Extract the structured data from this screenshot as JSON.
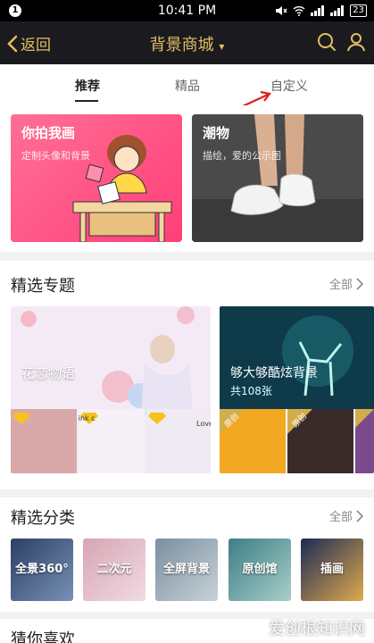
{
  "status_bar": {
    "notification_count": "1",
    "time": "10:41 PM",
    "battery": "23"
  },
  "nav": {
    "back_label": "返回",
    "title": "背景商城",
    "title_caret": "▾"
  },
  "tabs": [
    {
      "label": "推荐",
      "active": true
    },
    {
      "label": "精品",
      "active": false
    },
    {
      "label": "自定义",
      "active": false
    }
  ],
  "banners": [
    {
      "title": "你拍我画",
      "subtitle": "定制头像和背景"
    },
    {
      "title": "潮物",
      "subtitle": "描绘，爱的公示图"
    }
  ],
  "topics": {
    "title": "精选专题",
    "more_label": "全部",
    "cards": [
      {
        "title": "花恋物语",
        "thumb_text": "I'll think c",
        "thumb_love": "Love"
      },
      {
        "title": "够大够酷炫背景",
        "count": "共108张",
        "badge": "原创"
      }
    ]
  },
  "categories": {
    "title": "精选分类",
    "more_label": "全部",
    "items": [
      {
        "label": "全景360°"
      },
      {
        "label": "二次元"
      },
      {
        "label": "全屏背景"
      },
      {
        "label": "原创馆"
      },
      {
        "label": "插画"
      }
    ]
  },
  "guess": {
    "title": "猜你喜欢"
  },
  "watermark": "爱创根知识网",
  "colors": {
    "accent_gold": "#e3bd63",
    "navbar_bg": "#1b1b1f",
    "pink_banner": "#ff4f80",
    "arrow_red": "#d9211e"
  }
}
